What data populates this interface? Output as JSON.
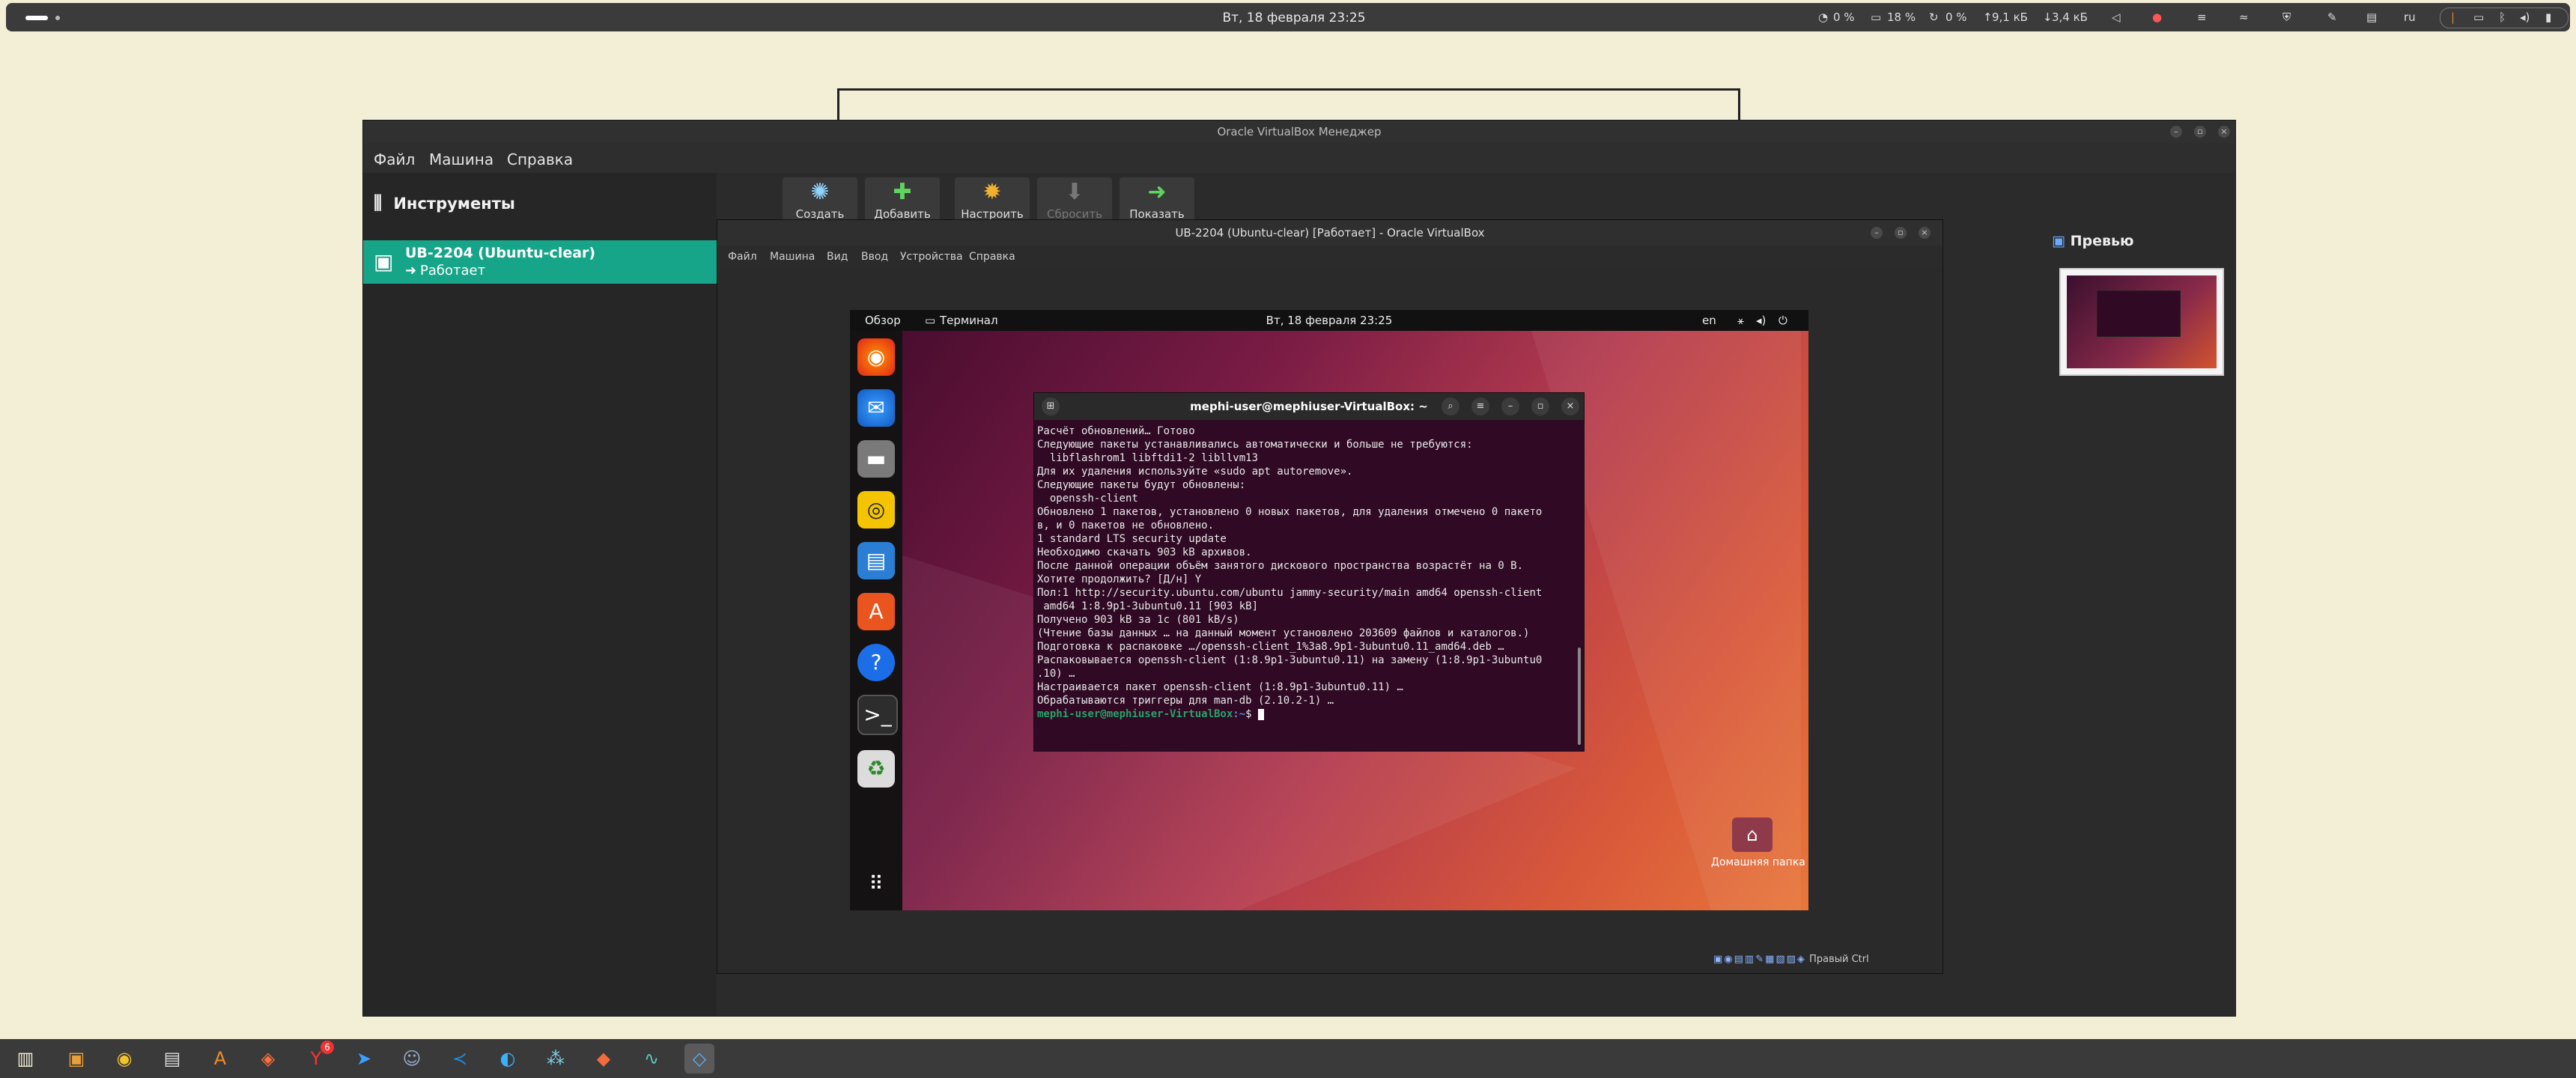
{
  "topbar": {
    "clock": "Вт, 18 февраля 23:25",
    "cpu": "0 %",
    "mem": "18 %",
    "swap": "0 %",
    "net_up": "9,1 кБ",
    "net_down": "3,4 кБ",
    "lang": "ru"
  },
  "vbm": {
    "title": "Oracle VirtualBox Менеджер",
    "menu": [
      "Файл",
      "Машина",
      "Справка"
    ],
    "tools_label": "Инструменты",
    "vm_name": "UB-2204 (Ubuntu-clear)",
    "vm_state": "Работает",
    "toolbar": [
      "Создать",
      "Добавить",
      "Настроить",
      "Сбросить",
      "Показать"
    ],
    "preview_label": "Превью"
  },
  "vmw": {
    "title": "UB-2204 (Ubuntu-clear) [Работает] - Oracle VirtualBox",
    "menu": [
      "Файл",
      "Машина",
      "Вид",
      "Ввод",
      "Устройства",
      "Справка"
    ],
    "host_key": "Правый Ctrl"
  },
  "ubuntu": {
    "activities": "Обзор",
    "app": "Терминал",
    "clock": "Вт, 18 февраля  23:25",
    "lang": "en",
    "home_label": "Домашняя папка"
  },
  "terminal": {
    "title": "mephi-user@mephiuser-VirtualBox: ~",
    "lines": [
      "Расчёт обновлений… Готово",
      "Следующие пакеты устанавливались автоматически и больше не требуются:",
      "  libflashrom1 libftdi1-2 libllvm13",
      "Для их удаления используйте «sudo apt autoremove».",
      "Следующие пакеты будут обновлены:",
      "  openssh-client",
      "Обновлено 1 пакетов, установлено 0 новых пакетов, для удаления отмечено 0 пакето",
      "в, и 0 пакетов не обновлено.",
      "1 standard LTS security update",
      "Необходимо скачать 903 kB архивов.",
      "После данной операции объём занятого дискового пространства возрастёт на 0 B.",
      "Хотите продолжить? [Д/н] Y",
      "Пол:1 http://security.ubuntu.com/ubuntu jammy-security/main amd64 openssh-client",
      " amd64 1:8.9p1-3ubuntu0.11 [903 kB]",
      "Получено 903 kB за 1c (801 kB/s)",
      "(Чтение базы данных … на данный момент установлено 203609 файлов и каталогов.)",
      "Подготовка к распаковке …/openssh-client_1%3a8.9p1-3ubuntu0.11_amd64.deb …",
      "Распаковывается openssh-client (1:8.9p1-3ubuntu0.11) на замену (1:8.9p1-3ubuntu0",
      ".10) …",
      "Настраивается пакет openssh-client (1:8.9p1-3ubuntu0.11) …",
      "Обрабатываются триггеры для man-db (2.10.2-1) …"
    ],
    "prompt_user": "mephi-user@mephiuser-VirtualBox",
    "prompt_path": ":~",
    "prompt_sign": "$ "
  },
  "taskbar": {
    "yandex_badge": "6"
  }
}
